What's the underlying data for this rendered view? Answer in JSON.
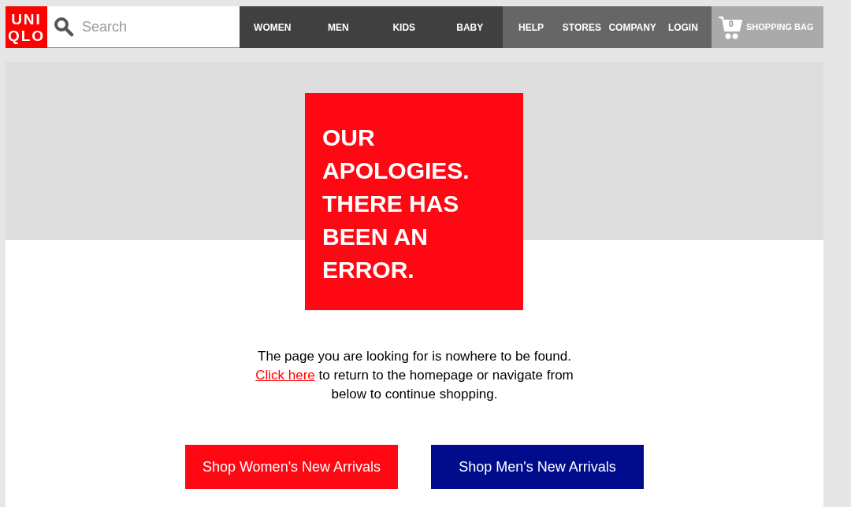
{
  "logo": {
    "lines": [
      "UNI",
      "QLO"
    ]
  },
  "search": {
    "placeholder": "Search"
  },
  "main_nav": [
    "WOMEN",
    "MEN",
    "KIDS",
    "BABY"
  ],
  "secondary_nav": [
    "HELP",
    "STORES",
    "COMPANY",
    "LOGIN"
  ],
  "shopping_bag": {
    "count": "0",
    "label": "SHOPPING BAG"
  },
  "error_heading": [
    "OUR",
    "APOLOGIES.",
    "THERE HAS",
    "BEEN AN",
    "ERROR."
  ],
  "message": {
    "line_1": "The page you are looking for is nowhere to be found.",
    "link": "Click here",
    "line_2": "to return to the homepage or navigate from below to continue shopping."
  },
  "buttons": [
    {
      "label": "Shop Women's New Arrivals",
      "color": "#ff0713"
    },
    {
      "label": "Shop Men's New Arrivals",
      "color": "#000c8c"
    }
  ]
}
